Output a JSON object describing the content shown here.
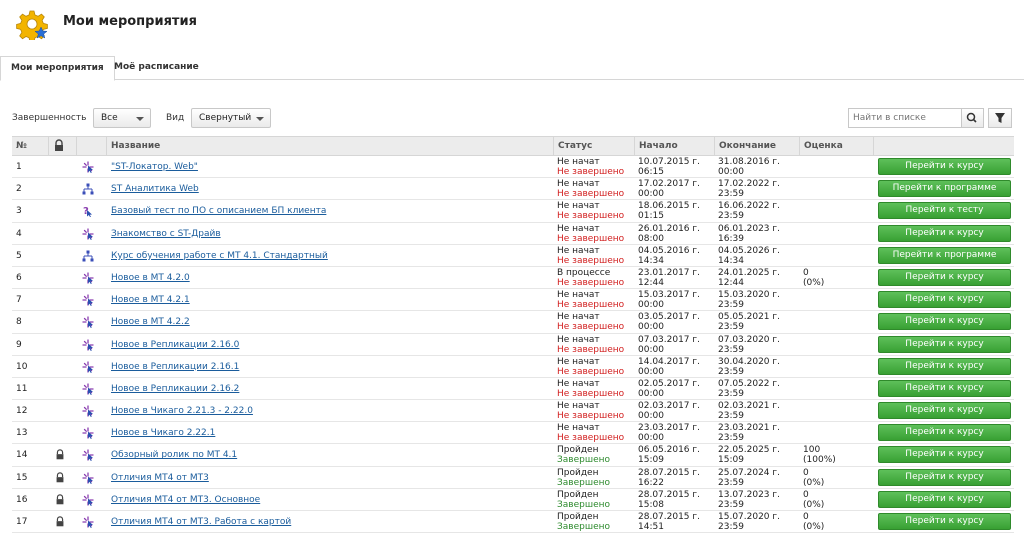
{
  "page": {
    "title": "Мои мероприятия"
  },
  "tabs": [
    {
      "label": "Мои мероприятия"
    },
    {
      "label": "Моё расписание"
    }
  ],
  "filters": {
    "completion_label": "Завершенность",
    "completion_value": "Все",
    "view_label": "Вид",
    "view_value": "Свернутый",
    "search_placeholder": "Найти в списке"
  },
  "table": {
    "headers": {
      "num": "№",
      "name": "Название",
      "status": "Статус",
      "start": "Начало",
      "end": "Окончание",
      "grade": "Оценка"
    },
    "rows": [
      {
        "num": "1",
        "locked": false,
        "icon": "course-icon",
        "name": "\"ST-Локатор. Web\"",
        "status": "Не начат",
        "state": "Не завершено",
        "start_date": "10.07.2015 г.",
        "start_time": "06:15",
        "end_date": "31.08.2016 г.",
        "end_time": "00:00",
        "grade": "",
        "grade_pct": "",
        "action": "Перейти к курсу"
      },
      {
        "num": "2",
        "locked": false,
        "icon": "program-icon",
        "name": "ST Аналитика Web",
        "status": "Не начат",
        "state": "Не завершено",
        "start_date": "17.02.2017 г.",
        "start_time": "00:00",
        "end_date": "17.02.2022 г.",
        "end_time": "23:59",
        "grade": "",
        "grade_pct": "",
        "action": "Перейти к программе"
      },
      {
        "num": "3",
        "locked": false,
        "icon": "test-icon",
        "name": "Базовый тест по ПО с описанием БП клиента",
        "status": "Не начат",
        "state": "Не завершено",
        "start_date": "18.06.2015 г.",
        "start_time": "01:15",
        "end_date": "16.06.2022 г.",
        "end_time": "23:59",
        "grade": "",
        "grade_pct": "",
        "action": "Перейти к тесту"
      },
      {
        "num": "4",
        "locked": false,
        "icon": "course-icon",
        "name": "Знакомство с ST-Драйв",
        "status": "Не начат",
        "state": "Не завершено",
        "start_date": "26.01.2016 г.",
        "start_time": "08:00",
        "end_date": "06.01.2023 г.",
        "end_time": "16:39",
        "grade": "",
        "grade_pct": "",
        "action": "Перейти к курсу"
      },
      {
        "num": "5",
        "locked": false,
        "icon": "program-icon",
        "name": "Курс обучения работе с МТ 4.1. Стандартный",
        "status": "Не начат",
        "state": "Не завершено",
        "start_date": "04.05.2016 г.",
        "start_time": "14:34",
        "end_date": "04.05.2026 г.",
        "end_time": "14:34",
        "grade": "",
        "grade_pct": "",
        "action": "Перейти к программе"
      },
      {
        "num": "6",
        "locked": false,
        "icon": "course-icon",
        "name": "Новое в МТ 4.2.0",
        "status": "В процессе",
        "state": "Не завершено",
        "start_date": "23.01.2017 г.",
        "start_time": "12:44",
        "end_date": "24.01.2025 г.",
        "end_time": "12:44",
        "grade": "0",
        "grade_pct": "(0%)",
        "action": "Перейти к курсу"
      },
      {
        "num": "7",
        "locked": false,
        "icon": "course-icon",
        "name": "Новое в МТ 4.2.1",
        "status": "Не начат",
        "state": "Не завершено",
        "start_date": "15.03.2017 г.",
        "start_time": "00:00",
        "end_date": "15.03.2020 г.",
        "end_time": "23:59",
        "grade": "",
        "grade_pct": "",
        "action": "Перейти к курсу"
      },
      {
        "num": "8",
        "locked": false,
        "icon": "course-icon",
        "name": "Новое в МТ 4.2.2",
        "status": "Не начат",
        "state": "Не завершено",
        "start_date": "03.05.2017 г.",
        "start_time": "00:00",
        "end_date": "05.05.2021 г.",
        "end_time": "23:59",
        "grade": "",
        "grade_pct": "",
        "action": "Перейти к курсу"
      },
      {
        "num": "9",
        "locked": false,
        "icon": "course-icon",
        "name": "Новое в Репликации 2.16.0",
        "status": "Не начат",
        "state": "Не завершено",
        "start_date": "07.03.2017 г.",
        "start_time": "00:00",
        "end_date": "07.03.2020 г.",
        "end_time": "23:59",
        "grade": "",
        "grade_pct": "",
        "action": "Перейти к курсу"
      },
      {
        "num": "10",
        "locked": false,
        "icon": "course-icon",
        "name": "Новое в Репликации 2.16.1",
        "status": "Не начат",
        "state": "Не завершено",
        "start_date": "14.04.2017 г.",
        "start_time": "00:00",
        "end_date": "30.04.2020 г.",
        "end_time": "23:59",
        "grade": "",
        "grade_pct": "",
        "action": "Перейти к курсу"
      },
      {
        "num": "11",
        "locked": false,
        "icon": "course-icon",
        "name": "Новое в Репликации 2.16.2",
        "status": "Не начат",
        "state": "Не завершено",
        "start_date": "02.05.2017 г.",
        "start_time": "00:00",
        "end_date": "07.05.2022 г.",
        "end_time": "23:59",
        "grade": "",
        "grade_pct": "",
        "action": "Перейти к курсу"
      },
      {
        "num": "12",
        "locked": false,
        "icon": "course-icon",
        "name": "Новое в Чикаго 2.21.3 - 2.22.0",
        "status": "Не начат",
        "state": "Не завершено",
        "start_date": "02.03.2017 г.",
        "start_time": "00:00",
        "end_date": "02.03.2021 г.",
        "end_time": "23:59",
        "grade": "",
        "grade_pct": "",
        "action": "Перейти к курсу"
      },
      {
        "num": "13",
        "locked": false,
        "icon": "course-icon",
        "name": "Новое в Чикаго 2.22.1",
        "status": "Не начат",
        "state": "Не завершено",
        "start_date": "23.03.2017 г.",
        "start_time": "00:00",
        "end_date": "23.03.2021 г.",
        "end_time": "23:59",
        "grade": "",
        "grade_pct": "",
        "action": "Перейти к курсу"
      },
      {
        "num": "14",
        "locked": true,
        "icon": "course-icon",
        "name": "Обзорный ролик по МТ 4.1",
        "status": "Пройден",
        "state": "Завершено",
        "start_date": "06.05.2016 г.",
        "start_time": "15:09",
        "end_date": "22.05.2025 г.",
        "end_time": "15:09",
        "grade": "100",
        "grade_pct": "(100%)",
        "action": "Перейти к курсу"
      },
      {
        "num": "15",
        "locked": true,
        "icon": "course-icon",
        "name": "Отличия МТ4 от МТ3",
        "status": "Пройден",
        "state": "Завершено",
        "start_date": "28.07.2015 г.",
        "start_time": "16:22",
        "end_date": "25.07.2024 г.",
        "end_time": "23:59",
        "grade": "0",
        "grade_pct": "(0%)",
        "action": "Перейти к курсу"
      },
      {
        "num": "16",
        "locked": true,
        "icon": "course-icon",
        "name": "Отличия МТ4 от МТ3. Основное",
        "status": "Пройден",
        "state": "Завершено",
        "start_date": "28.07.2015 г.",
        "start_time": "15:08",
        "end_date": "13.07.2023 г.",
        "end_time": "23:59",
        "grade": "0",
        "grade_pct": "(0%)",
        "action": "Перейти к курсу"
      },
      {
        "num": "17",
        "locked": true,
        "icon": "course-icon",
        "name": "Отличия МТ4 от МТ3. Работа с картой",
        "status": "Пройден",
        "state": "Завершено",
        "start_date": "28.07.2015 г.",
        "start_time": "14:51",
        "end_date": "15.07.2020 г.",
        "end_time": "23:59",
        "grade": "0",
        "grade_pct": "(0%)",
        "action": "Перейти к курсу"
      }
    ]
  }
}
